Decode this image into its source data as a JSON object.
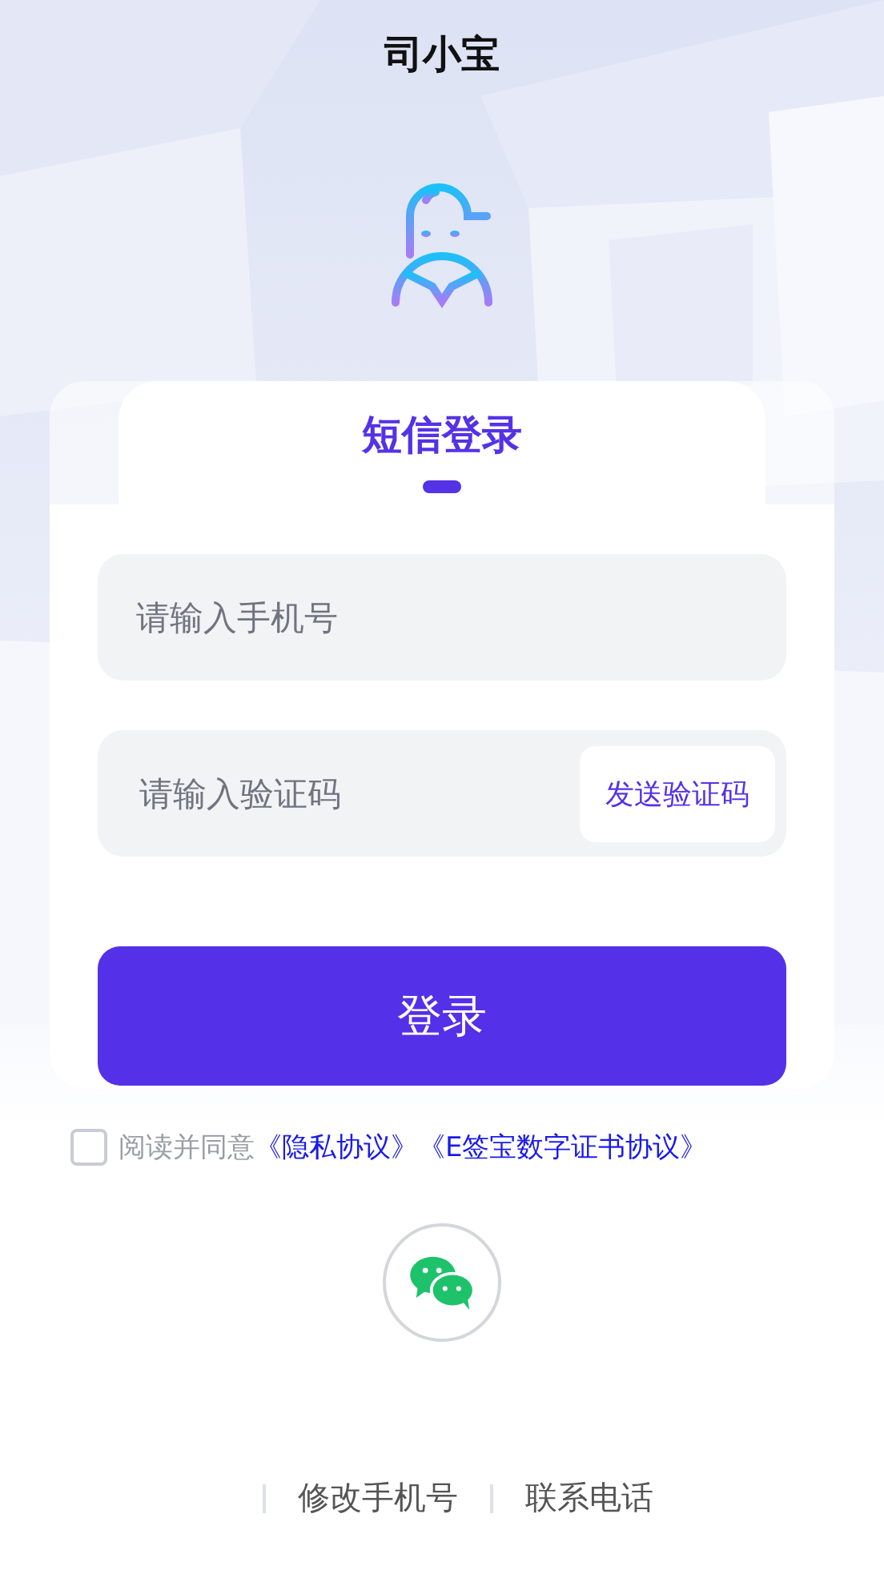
{
  "header": {
    "title": "司小宝"
  },
  "login_card": {
    "tabs": [
      {
        "label": "短信登录",
        "selected": true
      }
    ],
    "phone_field": {
      "placeholder": "请输入手机号"
    },
    "code_field": {
      "placeholder": "请输入验证码",
      "send_button": "发送验证码"
    },
    "login_button": "登录"
  },
  "agreement": {
    "checked": false,
    "text": "阅读并同意",
    "links": [
      "《隐私协议》",
      "《E签宝数字证书协议》"
    ]
  },
  "footer_links": [
    "修改手机号",
    "联系电话"
  ]
}
